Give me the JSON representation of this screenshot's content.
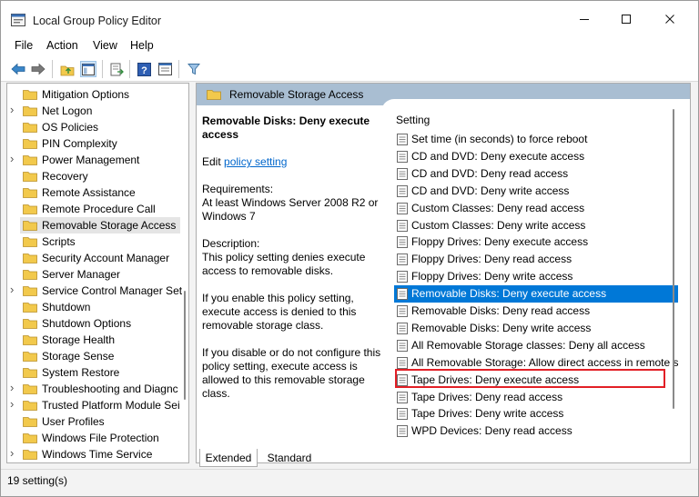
{
  "window": {
    "title": "Local Group Policy Editor",
    "minimize": "—",
    "maximize": "☐",
    "close": "✕"
  },
  "menu": [
    "File",
    "Action",
    "View",
    "Help"
  ],
  "toolbar": [
    "back-arrow-icon",
    "forward-arrow-icon",
    "up-folder-icon",
    "show-hide-tree-icon",
    "export-list-icon",
    "help-icon",
    "properties-pane-icon",
    "filter-icon"
  ],
  "tree": {
    "items": [
      {
        "label": "Mitigation Options",
        "expandable": false,
        "selected": false
      },
      {
        "label": "Net Logon",
        "expandable": true,
        "selected": false
      },
      {
        "label": "OS Policies",
        "expandable": false,
        "selected": false
      },
      {
        "label": "PIN Complexity",
        "expandable": false,
        "selected": false
      },
      {
        "label": "Power Management",
        "expandable": true,
        "selected": false
      },
      {
        "label": "Recovery",
        "expandable": false,
        "selected": false
      },
      {
        "label": "Remote Assistance",
        "expandable": false,
        "selected": false
      },
      {
        "label": "Remote Procedure Call",
        "expandable": false,
        "selected": false
      },
      {
        "label": "Removable Storage Access",
        "expandable": false,
        "selected": true
      },
      {
        "label": "Scripts",
        "expandable": false,
        "selected": false
      },
      {
        "label": "Security Account Manager",
        "expandable": false,
        "selected": false
      },
      {
        "label": "Server Manager",
        "expandable": false,
        "selected": false
      },
      {
        "label": "Service Control Manager Set",
        "expandable": true,
        "selected": false
      },
      {
        "label": "Shutdown",
        "expandable": false,
        "selected": false
      },
      {
        "label": "Shutdown Options",
        "expandable": false,
        "selected": false
      },
      {
        "label": "Storage Health",
        "expandable": false,
        "selected": false
      },
      {
        "label": "Storage Sense",
        "expandable": false,
        "selected": false
      },
      {
        "label": "System Restore",
        "expandable": false,
        "selected": false
      },
      {
        "label": "Troubleshooting and Diagnc",
        "expandable": true,
        "selected": false
      },
      {
        "label": "Trusted Platform Module Sei",
        "expandable": true,
        "selected": false
      },
      {
        "label": "User Profiles",
        "expandable": false,
        "selected": false
      },
      {
        "label": "Windows File Protection",
        "expandable": false,
        "selected": false
      },
      {
        "label": "Windows Time Service",
        "expandable": true,
        "selected": false
      }
    ]
  },
  "pane": {
    "header": "Removable Storage Access",
    "description": {
      "title": "Removable Disks: Deny execute access",
      "edit_prefix": "Edit",
      "edit_link": "policy setting",
      "requirements_label": "Requirements:",
      "requirements_text": "At least Windows Server 2008 R2 or Windows 7",
      "description_label": "Description:",
      "description_text": "This policy setting denies execute access to removable disks.",
      "enable_text": "If you enable this policy setting, execute access is denied to this removable storage class.",
      "disable_text": "If you disable or do not configure this policy setting, execute access is allowed to this removable storage class."
    },
    "settings_header": "Setting",
    "settings": [
      {
        "label": "Set time (in seconds) to force reboot",
        "selected": false
      },
      {
        "label": "CD and DVD: Deny execute access",
        "selected": false
      },
      {
        "label": "CD and DVD: Deny read access",
        "selected": false
      },
      {
        "label": "CD and DVD: Deny write access",
        "selected": false
      },
      {
        "label": "Custom Classes: Deny read access",
        "selected": false
      },
      {
        "label": "Custom Classes: Deny write access",
        "selected": false
      },
      {
        "label": "Floppy Drives: Deny execute access",
        "selected": false
      },
      {
        "label": "Floppy Drives: Deny read access",
        "selected": false
      },
      {
        "label": "Floppy Drives: Deny write access",
        "selected": false
      },
      {
        "label": "Removable Disks: Deny execute access",
        "selected": true
      },
      {
        "label": "Removable Disks: Deny read access",
        "selected": false
      },
      {
        "label": "Removable Disks: Deny write access",
        "selected": false
      },
      {
        "label": "All Removable Storage classes: Deny all access",
        "selected": false
      },
      {
        "label": "All Removable Storage: Allow direct access in remote sessions",
        "selected": false
      },
      {
        "label": "Tape Drives: Deny execute access",
        "selected": false
      },
      {
        "label": "Tape Drives: Deny read access",
        "selected": false
      },
      {
        "label": "Tape Drives: Deny write access",
        "selected": false
      },
      {
        "label": "WPD Devices: Deny read access",
        "selected": false
      }
    ]
  },
  "tabs": [
    "Extended",
    "Standard"
  ],
  "status": "19 setting(s)",
  "colors": {
    "selection": "#0078d7",
    "header_band": "#a9bed2",
    "highlight_box": "#e21f26",
    "link": "#0066cc"
  }
}
